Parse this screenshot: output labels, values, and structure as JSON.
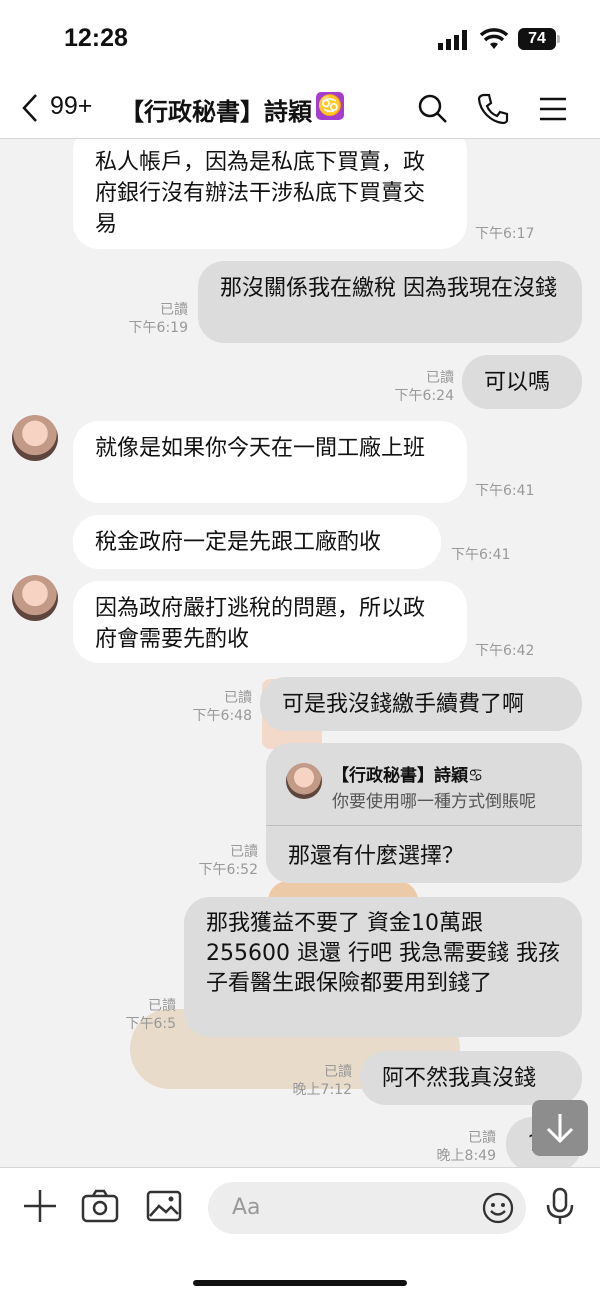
{
  "status_bar": {
    "time": "12:28",
    "battery": "74"
  },
  "header": {
    "back_count": "99+",
    "title": "【行政秘書】詩穎",
    "zodiac_emoji": "♋"
  },
  "messages": [
    {
      "dir": "in",
      "text": "私人帳戶，因為是私底下買賣，政府銀行沒有辦法干涉私底下買賣交易",
      "time": "下午6:17"
    },
    {
      "dir": "out",
      "text": "那沒關係我在繳稅  因為我現在沒錢",
      "read": "已讀",
      "time": "下午6:19"
    },
    {
      "dir": "out",
      "text": "可以嗎",
      "read": "已讀",
      "time": "下午6:24"
    },
    {
      "dir": "in",
      "text": "就像是如果你今天在一間工廠上班",
      "time": "下午6:41"
    },
    {
      "dir": "in",
      "text": "稅金政府一定是先跟工廠酌收",
      "time": "下午6:41"
    },
    {
      "dir": "in",
      "text": "因為政府嚴打逃稅的問題，所以政府會需要先酌收",
      "time": "下午6:42"
    },
    {
      "dir": "out",
      "text": "可是我沒錢繳手續費了啊",
      "read": "已讀",
      "time": "下午6:48"
    },
    {
      "dir": "out",
      "reply_to_name": "【行政秘書】詩穎♋",
      "reply_to_text": "你要使用哪一種方式倒賬呢",
      "text": "那還有什麼選擇？",
      "read": "已讀",
      "time": "下午6:52"
    },
    {
      "dir": "out",
      "text": "那我獲益不要了 資金10萬跟 255600 退還 行吧 我急需要錢 我孩子看醫生跟保險都要用到錢了",
      "read": "已讀",
      "time": "下午6:5"
    },
    {
      "dir": "out",
      "text": "阿不然我真沒錢",
      "read": "已讀",
      "time": "晚上7:12"
    },
    {
      "dir": "out",
      "text": "?",
      "read": "已讀",
      "time": "晚上8:49"
    }
  ],
  "input_bar": {
    "placeholder": "Aa"
  },
  "icons": [
    "chevron-left-icon",
    "search-icon",
    "phone-icon",
    "menu-icon",
    "plus-icon",
    "camera-icon",
    "image-icon",
    "emoji-icon",
    "mic-icon",
    "arrow-down-icon"
  ]
}
